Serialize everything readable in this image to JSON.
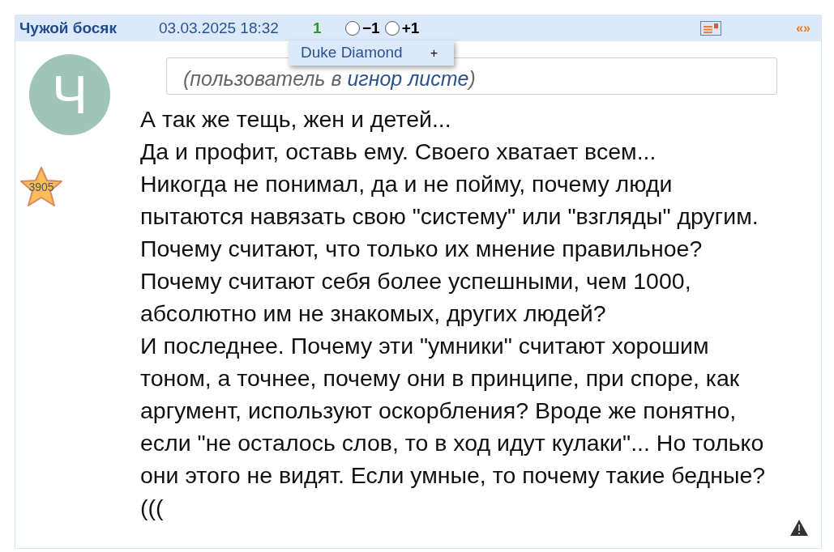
{
  "post": {
    "author": "Чужой босяк",
    "date": "03.03.2025 18:32",
    "rating": "1",
    "votes": [
      {
        "label": "−1",
        "selected": false
      },
      {
        "label": "+1",
        "selected": false
      }
    ],
    "popup": {
      "name": "Duke Diamond",
      "action": "+"
    },
    "nav": "«»",
    "avatar_letter": "Ч",
    "star_count": "3905",
    "ignore_note": {
      "prefix": "(пользователь в ",
      "link": "игнор листе",
      "suffix": ")"
    },
    "lines": [
      "А так же тещь, жен и детей...",
      "Да и профит, оставь ему. Своего хватает всем...",
      "Никогда не понимал, да и не пойму, почему люди",
      "пытаются навязать свою \"систему\" или \"взгляды\" другим.",
      "Почему считают, что только их мнение правильное?",
      "Почему считают себя более успешными, чем 1000,",
      "абсолютно им не знакомых, других людей?",
      "И последнее. Почему эти \"умники\" считают хорошим",
      "тоном, а точнее, почему они в принципе, при споре, как",
      "аргумент, используют оскорбления? Вроде же понятно,",
      "если \"не осталось слов, то в ход идут кулаки\"... Но только",
      "они этого не видят. Если умные, то почему такие бедные?",
      "((("
    ]
  }
}
